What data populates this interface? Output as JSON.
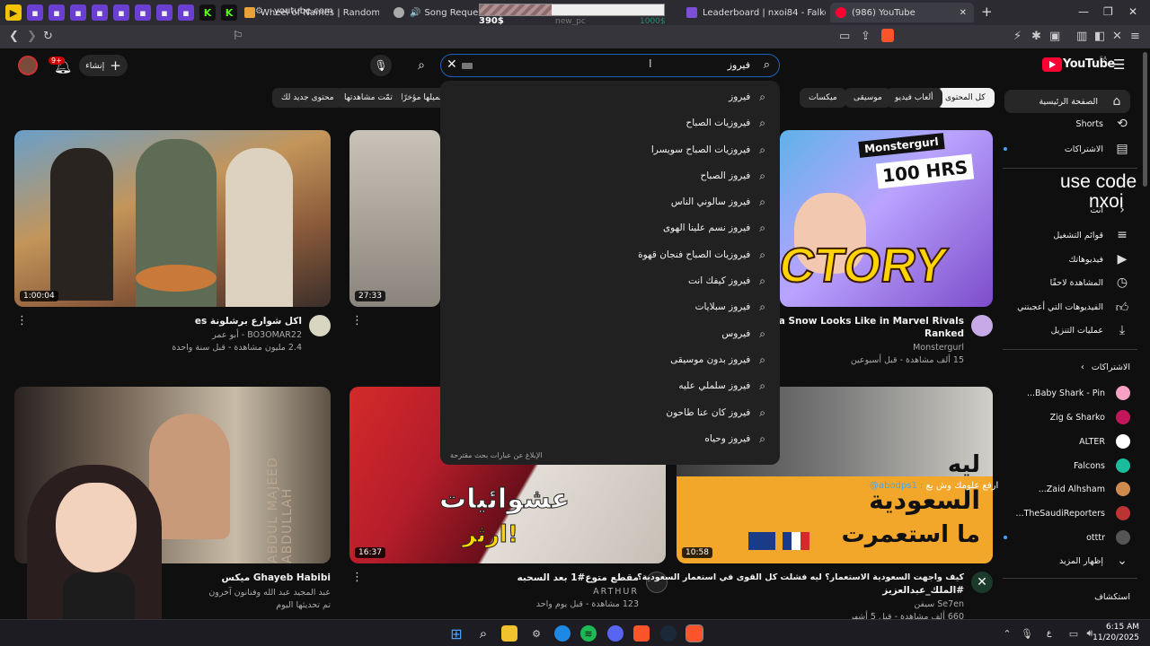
{
  "browser": {
    "tabs": [
      {
        "label": "Wheel of Names | Random name pic"
      },
      {
        "label": "Song Requests - Pl"
      },
      {
        "label": "Leaderboard | nxoi84 - Falkorie"
      },
      {
        "label": "(986) YouTube"
      }
    ],
    "url": "youtube.com"
  },
  "goal_overlay": {
    "current": "390$",
    "name": "new_pc",
    "target": "1000$",
    "progress": 0.39
  },
  "header": {
    "logo": "YouTube",
    "logo_region": "SA",
    "create_label": "إنشاء",
    "notif_badge": "9+",
    "search_value": "فيروز"
  },
  "suggestions": [
    "فيروز",
    "فيروزيات الصباح",
    "فيروزيات الصباح سويسرا",
    "فيروز الصباح",
    "فيروز سالوني الناس",
    "فيروز نسم علينا الهوى",
    "فيروزيات الصباح فنجان قهوة",
    "فيروز كيفك انت",
    "فيروز سبلايات",
    "فيروس",
    "فيروز بدون موسيقى",
    "فيروز سلملي عليه",
    "فيروز كان عنا طاحون",
    "فيروز وحياه"
  ],
  "report_suggestions": "الإبلاغ عن عبارات بحث مقترحة",
  "chips": [
    "كل المحتوى",
    "ألعاب فيديو",
    "موسيقى",
    "ميكسات",
    "تحميلها مؤخرًا",
    "تمّت مشاهدتها",
    "محتوى جديد لك"
  ],
  "sidebar": {
    "home": "الصفحة الرئيسية",
    "shorts": "Shorts",
    "subscriptions": "الاشتراكات",
    "you": "أنت",
    "playlists": "قوائم التشغيل",
    "your_videos": "فيديوهاتك",
    "watch_later": "المشاهدة لاحقًا",
    "liked": "الفيديوهات التي أعجبتني",
    "downloads": "عمليات التنزيل",
    "subs_title": "الاشتراكات",
    "channels": [
      "Baby Shark - Pin...",
      "Zig & Sharko",
      "ALTER",
      "Falcons",
      "Zaid Alhsham...",
      "TheSaudiReporters...",
      "otttr"
    ],
    "show_more": "إظهار المزيد",
    "explore": "استكشاف"
  },
  "videos": [
    {
      "title": "اكل شوارع برشلونة es",
      "channel": "BO3OMAR22 - أبو عمر",
      "meta": "2.4 مليون مشاهدة - قبل سنة واحدة",
      "duration": "1:00:04"
    },
    {
      "title": "",
      "channel": "",
      "meta": "",
      "duration": "27:33"
    },
    {
      "title": "s of Luna Snow Looks Like in Marvel Rivals",
      "title2": "Ranked",
      "channel": "Monstergurl",
      "meta": "15 ألف مشاهدة - قبل أسبوعين",
      "thumb_text1": "Monstergurl",
      "thumb_text2": "100 HRS",
      "thumb_text3": "CTORY"
    },
    {
      "title": "Ghayeb Habibi ميكس",
      "channel": "عبد المجيد عبد الله وفنانون آخرون",
      "meta": "تم تحديثها اليوم",
      "thumb_text": "ABDUL MAJEED ABDULLAH"
    },
    {
      "title": "مقطع متوع#1 بعد السحبه",
      "channel": "ARTHUR",
      "meta": "123 مشاهدة - قبل يوم واحد",
      "duration": "16:37",
      "thumb_text1": "عشوائيات",
      "thumb_text2": "ارثر!"
    },
    {
      "title": "كيف واجهت السعودية الاستعمار؟ ليه فشلت كل القوى في استعمار السعودية؟",
      "title2": "#الملك_عبدالعزيز",
      "channel": "Se7en سيفن",
      "meta": "660 ألف مشاهدة - قبل 5 أشهر",
      "duration": "10:58",
      "thumb_text1": "ليه",
      "thumb_text2": "السعودية",
      "thumb_text3": "ما استعمرت"
    }
  ],
  "overlay": {
    "use_code_line1": "use code",
    "use_code_line2": "nxoi",
    "chat_user": "@abodps1 :",
    "chat_msg": "ارفع علومك وش يع"
  },
  "taskbar": {
    "time": "6:15 AM",
    "date": "11/20/2025",
    "lang": "ع"
  },
  "colors": {
    "accent": "#3ea6ff",
    "youtube_red": "#ff0033",
    "search_border": "#1c62b9"
  }
}
